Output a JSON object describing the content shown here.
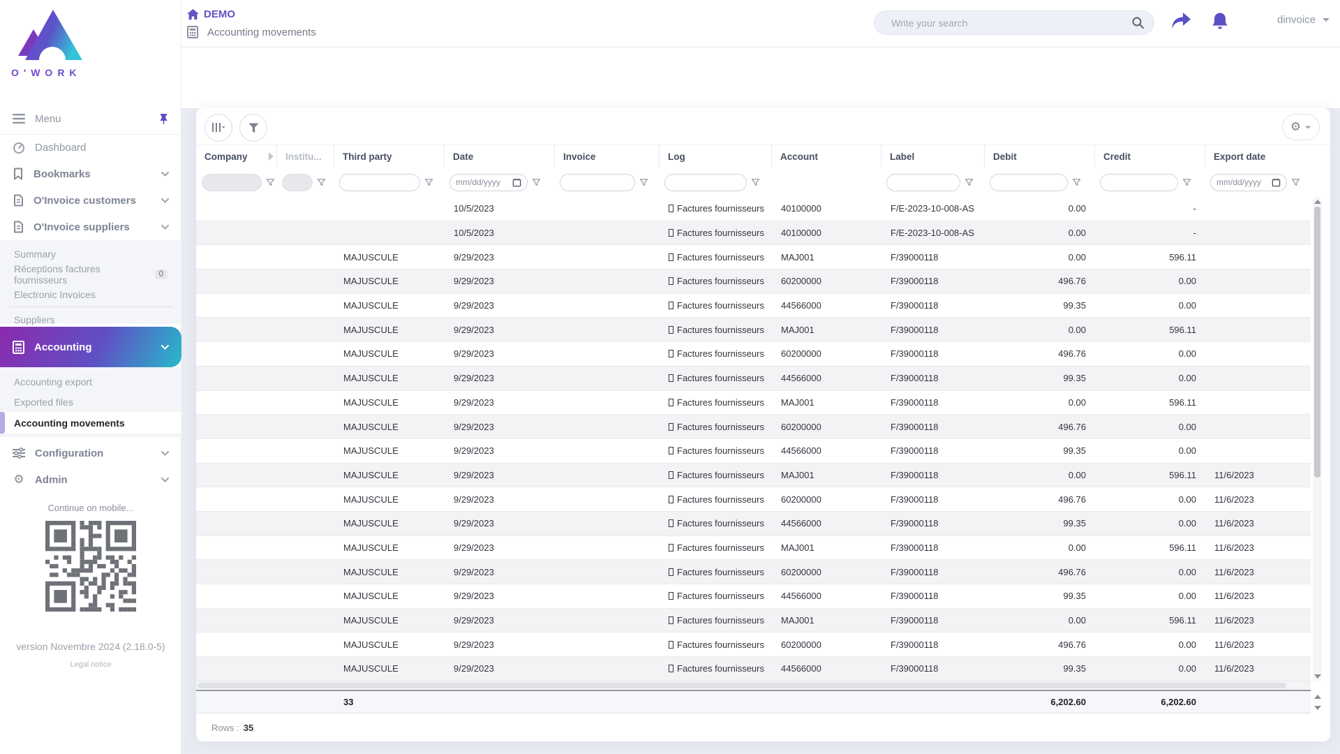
{
  "theme": {
    "accent_purple": "#5E50C8",
    "gradient_start": "#8A2BAE",
    "gradient_end": "#27B9C9",
    "page_background": "#E9EBF2",
    "text_dark": "#3F4254",
    "text_gray": "#8F96A3"
  },
  "header": {
    "brand": "O'WORK",
    "breadcrumb": "DEMO",
    "page_title": "Accounting movements",
    "search_placeholder": "Write your search",
    "username": "dinvoice"
  },
  "sidebar": {
    "menu": "Menu",
    "items": [
      "Dashboard",
      "Bookmarks",
      "O'Invoice customers",
      "O'Invoice suppliers"
    ],
    "suppliers_sub": {
      "summary": "Summary",
      "receptions": "Réceptions factures fournisseurs",
      "receptions_badge": "0",
      "electronic": "Electronic Invoices",
      "suppliers": "Suppliers"
    },
    "accounting": "Accounting",
    "accounting_sub": {
      "export": "Accounting export",
      "files": "Exported files",
      "movements": "Accounting movements"
    },
    "configuration": "Configuration",
    "admin": "Admin",
    "mobile": "Continue on mobile...",
    "version": "version Novembre 2024 (2.18.0-5)",
    "legal": "Legal notice"
  },
  "table": {
    "columns": [
      "Company",
      "Institu...",
      "Third party",
      "Date",
      "Invoice",
      "Log",
      "Account",
      "Label",
      "Debit",
      "Credit",
      "Export date"
    ],
    "date_placeholder": "mm/dd/yyyy",
    "rows": [
      {
        "company": "",
        "institution": "",
        "third_party": "",
        "date": "10/5/2023",
        "invoice": "",
        "log": "Factures fournisseurs",
        "account": "40100000",
        "label": "F/E-2023-10-008-AS",
        "debit": "0.00",
        "credit": "-",
        "export_date": ""
      },
      {
        "company": "",
        "institution": "",
        "third_party": "",
        "date": "10/5/2023",
        "invoice": "",
        "log": "Factures fournisseurs",
        "account": "40100000",
        "label": "F/E-2023-10-008-AS",
        "debit": "0.00",
        "credit": "-",
        "export_date": ""
      },
      {
        "company": "",
        "institution": "",
        "third_party": "MAJUSCULE",
        "date": "9/29/2023",
        "invoice": "",
        "log": "Factures fournisseurs",
        "account": "MAJ001",
        "label": "F/39000118",
        "debit": "0.00",
        "credit": "596.11",
        "export_date": ""
      },
      {
        "company": "",
        "institution": "",
        "third_party": "MAJUSCULE",
        "date": "9/29/2023",
        "invoice": "",
        "log": "Factures fournisseurs",
        "account": "60200000",
        "label": "F/39000118",
        "debit": "496.76",
        "credit": "0.00",
        "export_date": ""
      },
      {
        "company": "",
        "institution": "",
        "third_party": "MAJUSCULE",
        "date": "9/29/2023",
        "invoice": "",
        "log": "Factures fournisseurs",
        "account": "44566000",
        "label": "F/39000118",
        "debit": "99.35",
        "credit": "0.00",
        "export_date": ""
      },
      {
        "company": "",
        "institution": "",
        "third_party": "MAJUSCULE",
        "date": "9/29/2023",
        "invoice": "",
        "log": "Factures fournisseurs",
        "account": "MAJ001",
        "label": "F/39000118",
        "debit": "0.00",
        "credit": "596.11",
        "export_date": ""
      },
      {
        "company": "",
        "institution": "",
        "third_party": "MAJUSCULE",
        "date": "9/29/2023",
        "invoice": "",
        "log": "Factures fournisseurs",
        "account": "60200000",
        "label": "F/39000118",
        "debit": "496.76",
        "credit": "0.00",
        "export_date": ""
      },
      {
        "company": "",
        "institution": "",
        "third_party": "MAJUSCULE",
        "date": "9/29/2023",
        "invoice": "",
        "log": "Factures fournisseurs",
        "account": "44566000",
        "label": "F/39000118",
        "debit": "99.35",
        "credit": "0.00",
        "export_date": ""
      },
      {
        "company": "",
        "institution": "",
        "third_party": "MAJUSCULE",
        "date": "9/29/2023",
        "invoice": "",
        "log": "Factures fournisseurs",
        "account": "MAJ001",
        "label": "F/39000118",
        "debit": "0.00",
        "credit": "596.11",
        "export_date": ""
      },
      {
        "company": "",
        "institution": "",
        "third_party": "MAJUSCULE",
        "date": "9/29/2023",
        "invoice": "",
        "log": "Factures fournisseurs",
        "account": "60200000",
        "label": "F/39000118",
        "debit": "496.76",
        "credit": "0.00",
        "export_date": ""
      },
      {
        "company": "",
        "institution": "",
        "third_party": "MAJUSCULE",
        "date": "9/29/2023",
        "invoice": "",
        "log": "Factures fournisseurs",
        "account": "44566000",
        "label": "F/39000118",
        "debit": "99.35",
        "credit": "0.00",
        "export_date": ""
      },
      {
        "company": "",
        "institution": "",
        "third_party": "MAJUSCULE",
        "date": "9/29/2023",
        "invoice": "",
        "log": "Factures fournisseurs",
        "account": "MAJ001",
        "label": "F/39000118",
        "debit": "0.00",
        "credit": "596.11",
        "export_date": "11/6/2023"
      },
      {
        "company": "",
        "institution": "",
        "third_party": "MAJUSCULE",
        "date": "9/29/2023",
        "invoice": "",
        "log": "Factures fournisseurs",
        "account": "60200000",
        "label": "F/39000118",
        "debit": "496.76",
        "credit": "0.00",
        "export_date": "11/6/2023"
      },
      {
        "company": "",
        "institution": "",
        "third_party": "MAJUSCULE",
        "date": "9/29/2023",
        "invoice": "",
        "log": "Factures fournisseurs",
        "account": "44566000",
        "label": "F/39000118",
        "debit": "99.35",
        "credit": "0.00",
        "export_date": "11/6/2023"
      },
      {
        "company": "",
        "institution": "",
        "third_party": "MAJUSCULE",
        "date": "9/29/2023",
        "invoice": "",
        "log": "Factures fournisseurs",
        "account": "MAJ001",
        "label": "F/39000118",
        "debit": "0.00",
        "credit": "596.11",
        "export_date": "11/6/2023"
      },
      {
        "company": "",
        "institution": "",
        "third_party": "MAJUSCULE",
        "date": "9/29/2023",
        "invoice": "",
        "log": "Factures fournisseurs",
        "account": "60200000",
        "label": "F/39000118",
        "debit": "496.76",
        "credit": "0.00",
        "export_date": "11/6/2023"
      },
      {
        "company": "",
        "institution": "",
        "third_party": "MAJUSCULE",
        "date": "9/29/2023",
        "invoice": "",
        "log": "Factures fournisseurs",
        "account": "44566000",
        "label": "F/39000118",
        "debit": "99.35",
        "credit": "0.00",
        "export_date": "11/6/2023"
      },
      {
        "company": "",
        "institution": "",
        "third_party": "MAJUSCULE",
        "date": "9/29/2023",
        "invoice": "",
        "log": "Factures fournisseurs",
        "account": "MAJ001",
        "label": "F/39000118",
        "debit": "0.00",
        "credit": "596.11",
        "export_date": "11/6/2023"
      },
      {
        "company": "",
        "institution": "",
        "third_party": "MAJUSCULE",
        "date": "9/29/2023",
        "invoice": "",
        "log": "Factures fournisseurs",
        "account": "60200000",
        "label": "F/39000118",
        "debit": "496.76",
        "credit": "0.00",
        "export_date": "11/6/2023"
      },
      {
        "company": "",
        "institution": "",
        "third_party": "MAJUSCULE",
        "date": "9/29/2023",
        "invoice": "",
        "log": "Factures fournisseurs",
        "account": "44566000",
        "label": "F/39000118",
        "debit": "99.35",
        "credit": "0.00",
        "export_date": "11/6/2023"
      }
    ],
    "totals": {
      "third_party": "33",
      "debit": "6,202.60",
      "credit": "6,202.60"
    },
    "footer": {
      "rows_label": "Rows :",
      "rows_value": "35"
    }
  }
}
